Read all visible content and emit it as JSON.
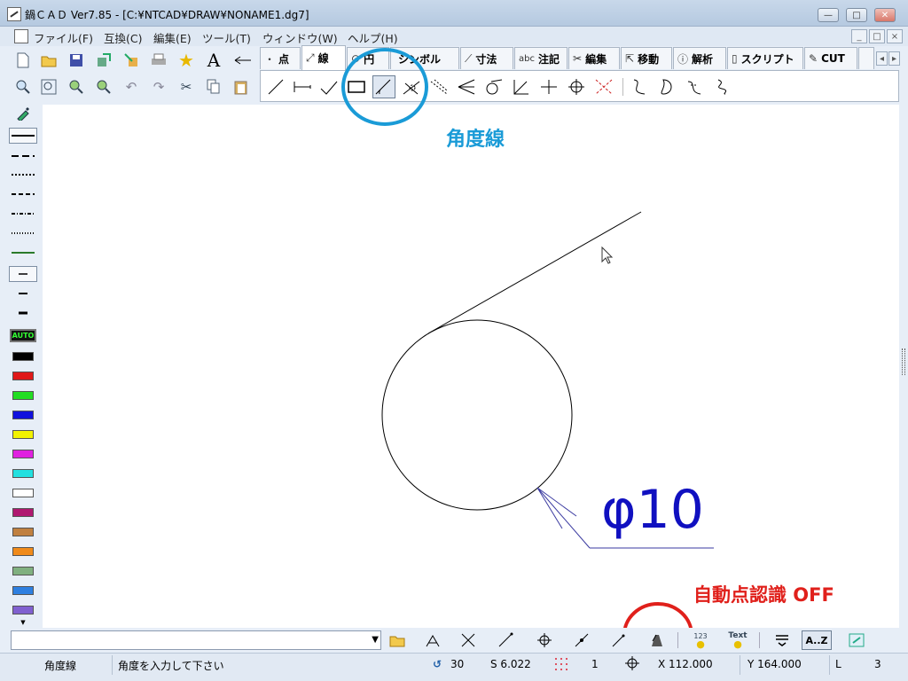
{
  "window": {
    "title": "鍋ＣＡＤ Ver7.85 - [C:¥NTCAD¥DRAW¥NONAME1.dg7]",
    "minimize": "—",
    "maximize": "□",
    "close": "✕"
  },
  "menu": {
    "items": [
      "ファイル(F)",
      "互換(C)",
      "編集(E)",
      "ツール(T)",
      "ウィンドウ(W)",
      "ヘルプ(H)"
    ],
    "mdi": [
      "_",
      "□",
      "×"
    ]
  },
  "tabs": [
    {
      "label": "点",
      "icon": "・"
    },
    {
      "label": "線",
      "icon": "⤢"
    },
    {
      "label": "円",
      "icon": "⊙"
    },
    {
      "label": "シンボル",
      "icon": ""
    },
    {
      "label": "寸法",
      "icon": "⟋"
    },
    {
      "label": "注記",
      "icon": "abc"
    },
    {
      "label": "編集",
      "icon": "✂"
    },
    {
      "label": "移動",
      "icon": "⇱"
    },
    {
      "label": "解析",
      "icon": "ⓘ"
    },
    {
      "label": "スクリプト",
      "icon": "▯"
    },
    {
      "label": "CUT",
      "icon": "✎"
    }
  ],
  "toolbar_text_icon": "A",
  "annotations": {
    "angle_line": "角度線",
    "auto_point": "自動点認識 OFF"
  },
  "drawing": {
    "dimension_text": "φ10"
  },
  "cmdbar": {
    "az_label": "A..Z",
    "num_label": "123",
    "text_label": "Text"
  },
  "left_palette": {
    "auto_label": "AUTO",
    "colors": [
      "#000000",
      "#e01818",
      "#22dd22",
      "#1010dd",
      "#f2f200",
      "#e020e0",
      "#22e0e0",
      "#ffffff",
      "#b01870",
      "#c08040",
      "#f08a1a",
      "#80b080",
      "#2e7fe0",
      "#8060d0"
    ]
  },
  "status": {
    "mode": "角度線",
    "prompt": "角度を入力して下さい",
    "angle": "30",
    "scale": "S 6.022",
    "layer": "1",
    "x": "X 112.000",
    "y": "Y 164.000",
    "l_label": "L",
    "l_value": "3"
  }
}
